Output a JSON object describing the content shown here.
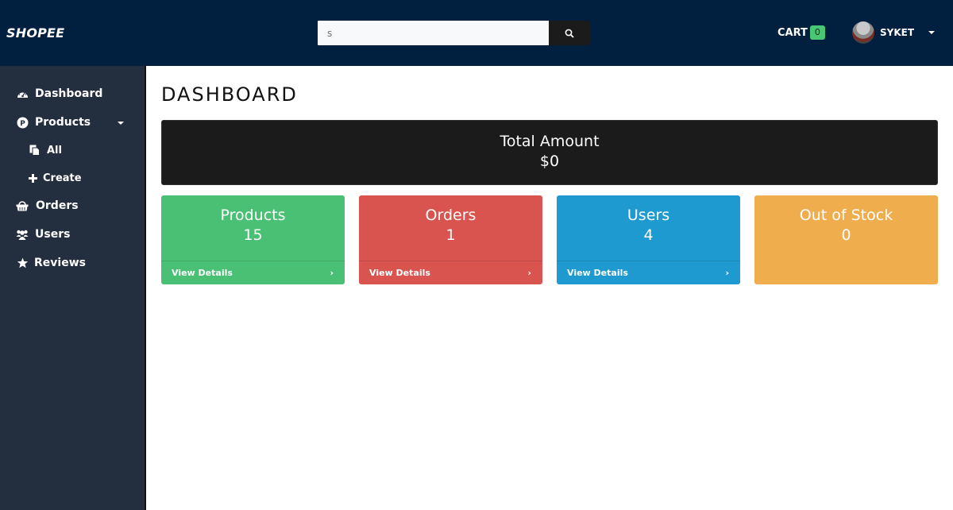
{
  "navbar": {
    "brand": "SHOPEE",
    "search": {
      "value": "s",
      "placeholder": ""
    },
    "cart": {
      "label": "CART",
      "count": "0"
    },
    "user": {
      "name": "SYKET"
    }
  },
  "sidebar": {
    "items": [
      {
        "label": "Dashboard",
        "icon": "dashboard-icon"
      },
      {
        "label": "Products",
        "icon": "product-icon"
      },
      {
        "label": "All",
        "icon": "copy-icon"
      },
      {
        "label": "Create",
        "icon": "plus-icon"
      },
      {
        "label": "Orders",
        "icon": "basket-icon"
      },
      {
        "label": "Users",
        "icon": "users-icon"
      },
      {
        "label": "Reviews",
        "icon": "star-icon"
      }
    ]
  },
  "main": {
    "title": "DASHBOARD",
    "total": {
      "label": "Total Amount",
      "value": "$0"
    },
    "cards": [
      {
        "title": "Products",
        "count": "15",
        "link": "View Details",
        "color": "#4ac074"
      },
      {
        "title": "Orders",
        "count": "1",
        "link": "View Details",
        "color": "#d9534f"
      },
      {
        "title": "Users",
        "count": "4",
        "link": "View Details",
        "color": "#1f9ad0"
      },
      {
        "title": "Out of Stock",
        "count": "0",
        "color": "#efad4d"
      }
    ]
  }
}
